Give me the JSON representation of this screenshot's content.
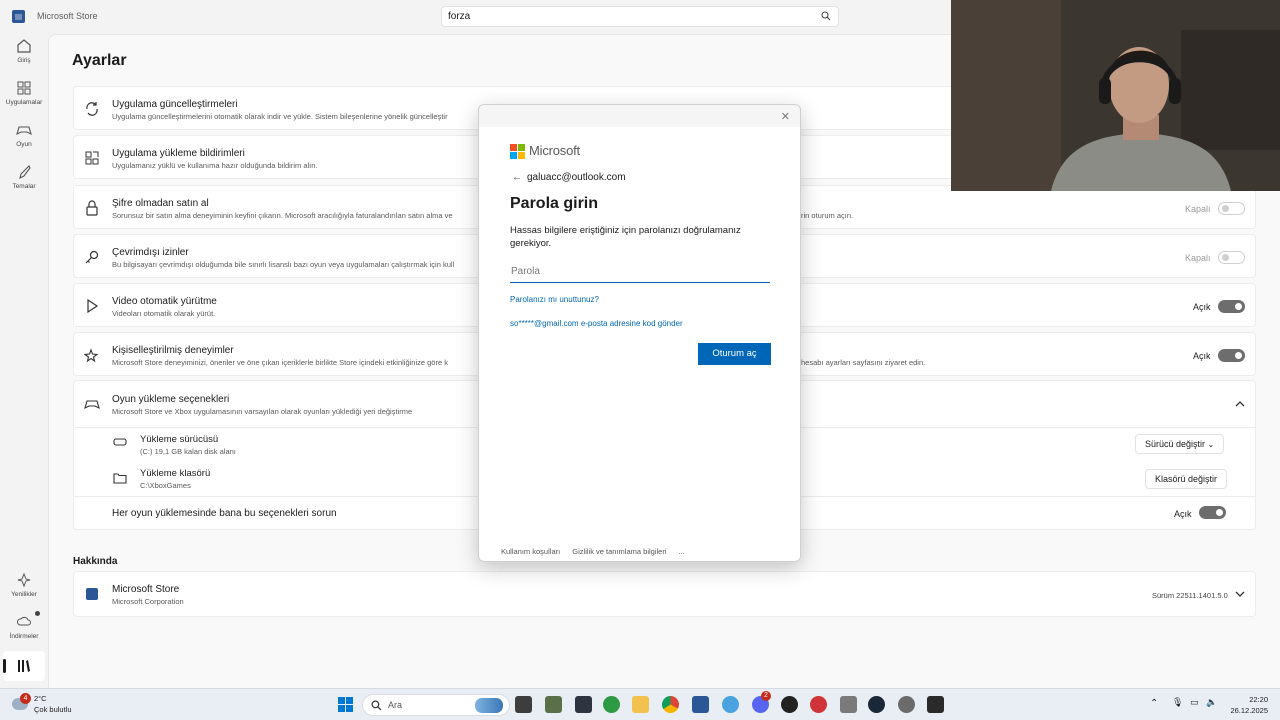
{
  "app": {
    "title": "Microsoft Store"
  },
  "search": {
    "value": "forza"
  },
  "sidebar": {
    "items": [
      {
        "label": "Giriş"
      },
      {
        "label": "Uygulamalar"
      },
      {
        "label": "Oyun"
      },
      {
        "label": "Temalar"
      },
      {
        "label": "Yenilikler"
      },
      {
        "label": "İndirmeler"
      }
    ]
  },
  "page": {
    "title": "Ayarlar"
  },
  "settings": [
    {
      "title": "Uygulama güncelleştirmeleri",
      "desc": "Uygulama güncelleştirmelerini otomatik olarak indir ve yükle. Sistem bileşenlerine yönelik güncelleştir"
    },
    {
      "title": "Uygulama yükleme bildirimleri",
      "desc": "Uygulamanız yüklü ve kullanıma hazır olduğunda bildirim alın."
    },
    {
      "title": "Şifre olmadan satın al",
      "desc": "Sorunsuz bir satın alma deneyiminin keyfini çıkarın. Microsoft aracılığıyla faturalandırılan satın alma ve",
      "desc_tail": "rin oturum açın.",
      "toggle_label": "Kapalı"
    },
    {
      "title": "Çevrimdışı izinler",
      "desc": "Bu bilgisayarı çevrimdışı olduğumda bile sınırlı lisanslı bazı oyun veya uygulamaları çalıştırmak için kull",
      "toggle_label": "Kapalı"
    },
    {
      "title": "Video otomatik yürütme",
      "desc": "Videoları otomatik olarak yürüt.",
      "toggle_label": "Açık"
    },
    {
      "title": "Kişiselleştirilmiş deneyimler",
      "desc": "Microsoft Store deneyiminizi, öneriler ve öne çıkan içeriklerle birlikte Store içindeki etkinliğinize göre k",
      "desc_tail": "hesabı ayarları sayfasını ziyaret edin.",
      "toggle_label": "Açık"
    }
  ],
  "install_options": {
    "title": "Oyun yükleme seçenekleri",
    "desc": "Microsoft Store ve Xbox uygulamasının varsayılan olarak oyunları yüklediği yeri değiştirme",
    "drive": {
      "title": "Yükleme sürücüsü",
      "desc": "(C:) 19,1 GB kalan disk alanı",
      "button": "Sürücü değiştir"
    },
    "folder": {
      "title": "Yükleme klasörü",
      "desc": "C:\\XboxGames",
      "button": "Klasörü değiştir"
    },
    "ask": {
      "title": "Her oyun yüklemesinde bana bu seçenekleri sorun",
      "toggle_label": "Açık"
    }
  },
  "about": {
    "section_title": "Hakkında",
    "title": "Microsoft Store",
    "desc": "Microsoft Corporation",
    "version": "Sürüm 22511.1401.5.0"
  },
  "modal": {
    "brand": "Microsoft",
    "account": "galuacc@outlook.com",
    "heading": "Parola girin",
    "text": "Hassas bilgilere eriştiğiniz için parolanızı doğrulamanız gerekiyor.",
    "password_placeholder": "Parola",
    "forgot_link": "Parolanızı mı unuttunuz?",
    "email_code_link": "so*****@gmail.com e-posta adresine kod gönder",
    "submit": "Oturum aç",
    "footer": [
      "Kullanım koşulları",
      "Gizlilik ve tanımlama bilgileri",
      "..."
    ]
  },
  "taskbar": {
    "weather_badge": "4",
    "temp": "2°C",
    "weather_desc": "Çok bulutlu",
    "search_placeholder": "Ara",
    "chat_badge": "2",
    "time": "22:20",
    "date": "26.12.2025"
  },
  "colors": {
    "accent": "#0067b8",
    "toggle_on": "#6d6d6d"
  }
}
